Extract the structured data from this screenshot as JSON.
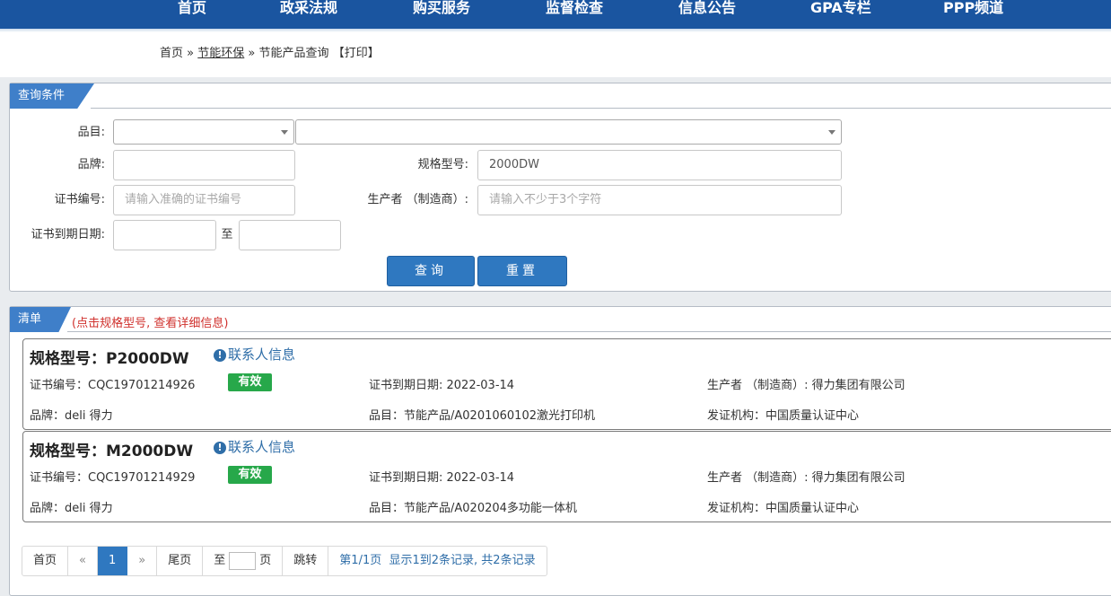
{
  "nav": {
    "items": [
      "首页",
      "政采法规",
      "购买服务",
      "监督检查",
      "信息公告",
      "GPA专栏",
      "PPP频道"
    ]
  },
  "breadcrumb": {
    "home": "首页",
    "sep1": "»",
    "section": "节能环保",
    "sep2": "»",
    "current": "节能产品查询",
    "print": "【打印】"
  },
  "query_panel": {
    "title": "查询条件",
    "category_label": "品目:",
    "brand_label": "品牌:",
    "brand_value": "",
    "model_label": "规格型号:",
    "model_value": "2000DW",
    "cert_label": "证书编号:",
    "cert_placeholder": "请输入准确的证书编号",
    "maker_label": "生产者 （制造商）:",
    "maker_placeholder": "请输入不少于3个字符",
    "expiry_label": "证书到期日期:",
    "to_label": "至",
    "search_button": "查询",
    "reset_button": "重置"
  },
  "list_panel": {
    "title": "清单",
    "note": "(点击规格型号, 查看详细信息)",
    "contact_label": "联系人信息",
    "items": [
      {
        "model": "规格型号：P2000DW",
        "cert": "证书编号：CQC19701214926",
        "status": "有效",
        "expiry": "证书到期日期: 2022-03-14",
        "maker": "生产者 （制造商）: 得力集团有限公司",
        "brand": "品牌：deli 得力",
        "category": "品目：节能产品/A0201060102激光打印机",
        "issuer": "发证机构：中国质量认证中心"
      },
      {
        "model": "规格型号：M2000DW",
        "cert": "证书编号：CQC19701214929",
        "status": "有效",
        "expiry": "证书到期日期: 2022-03-14",
        "maker": "生产者 （制造商）: 得力集团有限公司",
        "brand": "品牌：deli 得力",
        "category": "品目：节能产品/A020204多功能一体机",
        "issuer": "发证机构：中国质量认证中心"
      }
    ]
  },
  "pager": {
    "first": "首页",
    "prev": "«",
    "current": "1",
    "next": "»",
    "last": "尾页",
    "goto_prefix": "至",
    "goto_suffix": "页",
    "jump": "跳转",
    "page_info": "第1/1页",
    "record_info": "显示1到2条记录, 共2条记录"
  },
  "colors": {
    "nav_bg": "#1a55a0",
    "accent": "#2f78c0",
    "valid_badge": "#27a84a",
    "note_red": "#d0312d"
  }
}
